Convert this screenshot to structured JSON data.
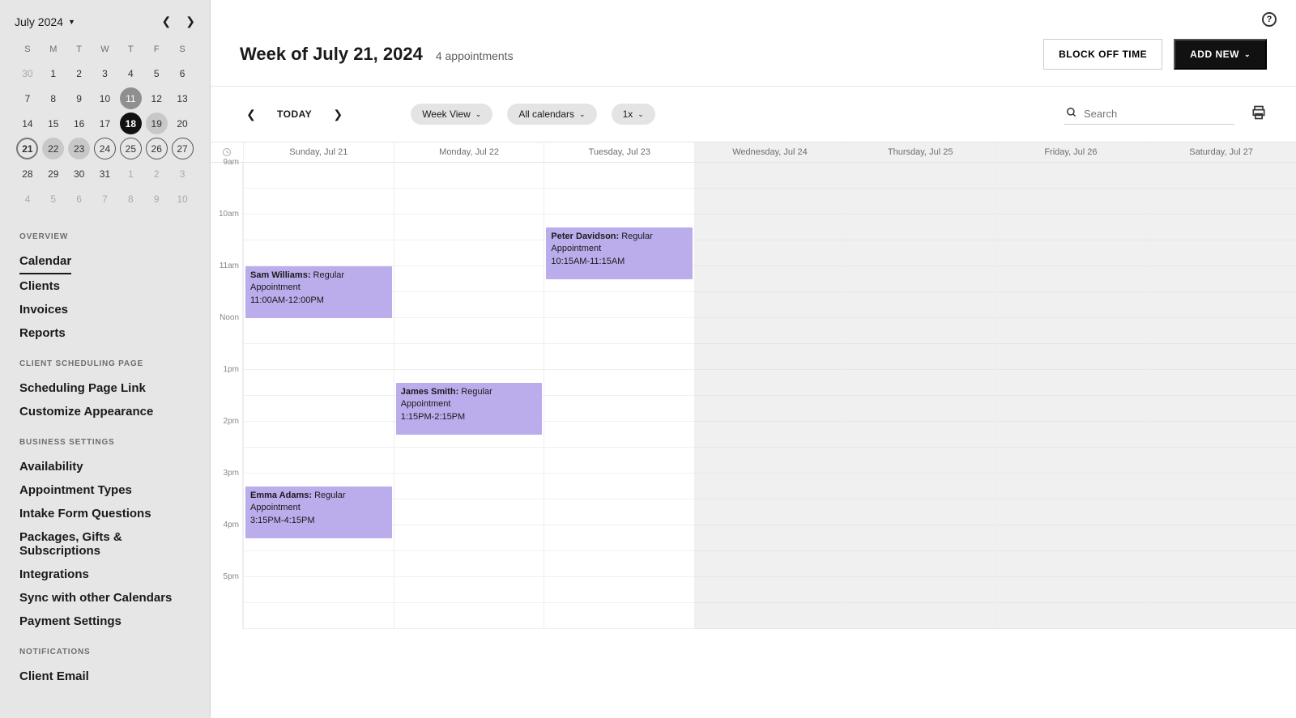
{
  "mini_calendar": {
    "month_label": "July 2024",
    "dow": [
      "S",
      "M",
      "T",
      "W",
      "T",
      "F",
      "S"
    ],
    "days": [
      {
        "n": 30,
        "cls": "muted"
      },
      {
        "n": 1
      },
      {
        "n": 2
      },
      {
        "n": 3
      },
      {
        "n": 4
      },
      {
        "n": 5
      },
      {
        "n": 6
      },
      {
        "n": 7
      },
      {
        "n": 8
      },
      {
        "n": 9
      },
      {
        "n": 10
      },
      {
        "n": 11,
        "cls": "filled-dark"
      },
      {
        "n": 12
      },
      {
        "n": 13
      },
      {
        "n": 14
      },
      {
        "n": 15
      },
      {
        "n": 16
      },
      {
        "n": 17
      },
      {
        "n": 18,
        "cls": "today"
      },
      {
        "n": 19,
        "cls": "filled-light"
      },
      {
        "n": 20
      },
      {
        "n": 21,
        "cls": "outline-dark"
      },
      {
        "n": 22,
        "cls": "filled-light"
      },
      {
        "n": 23,
        "cls": "filled-light"
      },
      {
        "n": 24,
        "cls": "ring"
      },
      {
        "n": 25,
        "cls": "ring"
      },
      {
        "n": 26,
        "cls": "ring"
      },
      {
        "n": 27,
        "cls": "ring"
      },
      {
        "n": 28
      },
      {
        "n": 29
      },
      {
        "n": 30
      },
      {
        "n": 31
      },
      {
        "n": 1,
        "cls": "muted"
      },
      {
        "n": 2,
        "cls": "muted"
      },
      {
        "n": 3,
        "cls": "muted"
      },
      {
        "n": 4,
        "cls": "muted"
      },
      {
        "n": 5,
        "cls": "muted"
      },
      {
        "n": 6,
        "cls": "muted"
      },
      {
        "n": 7,
        "cls": "muted"
      },
      {
        "n": 8,
        "cls": "muted"
      },
      {
        "n": 9,
        "cls": "muted"
      },
      {
        "n": 10,
        "cls": "muted"
      }
    ]
  },
  "nav": {
    "sections": [
      {
        "heading": "OVERVIEW",
        "items": [
          {
            "label": "Calendar",
            "active": true
          },
          {
            "label": "Clients"
          },
          {
            "label": "Invoices"
          },
          {
            "label": "Reports"
          }
        ]
      },
      {
        "heading": "CLIENT SCHEDULING PAGE",
        "items": [
          {
            "label": "Scheduling Page Link"
          },
          {
            "label": "Customize Appearance"
          }
        ]
      },
      {
        "heading": "BUSINESS SETTINGS",
        "items": [
          {
            "label": "Availability"
          },
          {
            "label": "Appointment Types"
          },
          {
            "label": "Intake Form Questions"
          },
          {
            "label": "Packages, Gifts & Subscriptions"
          },
          {
            "label": "Integrations"
          },
          {
            "label": "Sync with other Calendars"
          },
          {
            "label": "Payment Settings"
          }
        ]
      },
      {
        "heading": "NOTIFICATIONS",
        "items": [
          {
            "label": "Client Email"
          }
        ]
      }
    ]
  },
  "header": {
    "title": "Week of July 21, 2024",
    "count": "4 appointments",
    "block_off": "BLOCK OFF TIME",
    "add_new": "ADD NEW"
  },
  "toolbar": {
    "today": "TODAY",
    "view_pill": "Week View",
    "cal_pill": "All calendars",
    "zoom_pill": "1x",
    "search_placeholder": "Search"
  },
  "week": {
    "days": [
      {
        "label": "Sunday, Jul 21",
        "grey": false
      },
      {
        "label": "Monday, Jul 22",
        "grey": false
      },
      {
        "label": "Tuesday, Jul 23",
        "grey": false
      },
      {
        "label": "Wednesday, Jul 24",
        "grey": true
      },
      {
        "label": "Thursday, Jul 25",
        "grey": true
      },
      {
        "label": "Friday, Jul 26",
        "grey": true
      },
      {
        "label": "Saturday, Jul 27",
        "grey": true
      }
    ],
    "time_labels": [
      "9am",
      "",
      "10am",
      "",
      "11am",
      "",
      "Noon",
      "",
      "1pm",
      "",
      "2pm",
      "",
      "3pm",
      "",
      "4pm",
      "",
      "5pm",
      ""
    ],
    "slot_count": 18,
    "events": [
      {
        "day": 0,
        "start": 4,
        "dur": 2,
        "name": "Sam Williams:",
        "type": "Regular Appointment",
        "time": "11:00AM-12:00PM"
      },
      {
        "day": 0,
        "start": 12.5,
        "dur": 2,
        "name": "Emma Adams:",
        "type": "Regular Appointment",
        "time": "3:15PM-4:15PM"
      },
      {
        "day": 1,
        "start": 8.5,
        "dur": 2,
        "name": "James Smith:",
        "type": "Regular Appointment",
        "time": "1:15PM-2:15PM"
      },
      {
        "day": 2,
        "start": 2.5,
        "dur": 2,
        "name": "Peter Davidson:",
        "type": "Regular Appointment",
        "time": "10:15AM-11:15AM"
      }
    ]
  }
}
